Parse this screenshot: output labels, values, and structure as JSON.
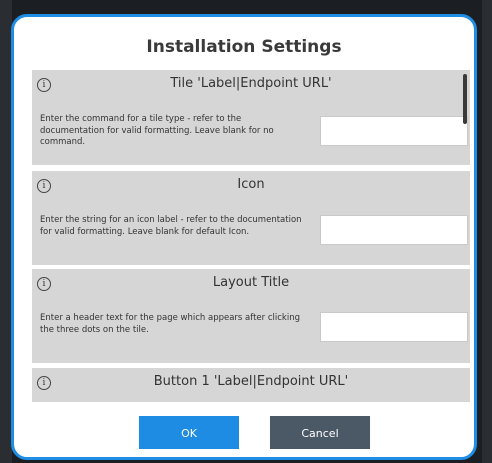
{
  "dialog": {
    "title": "Installation Settings",
    "accent_color": "#1f8de3"
  },
  "settings": [
    {
      "icon": "info-icon",
      "title": "Tile 'Label|Endpoint URL'",
      "description": "Enter the command for a tile type - refer to the documentation for valid formatting.  Leave blank for no command.",
      "value": ""
    },
    {
      "icon": "info-icon",
      "title": "Icon",
      "description": "Enter the string for an icon label - refer to the documentation for valid formatting. Leave blank for default Icon.",
      "value": ""
    },
    {
      "icon": "info-icon",
      "title": "Layout Title",
      "description": "Enter a header text for the page which appears after clicking the three dots on the tile.",
      "value": ""
    },
    {
      "icon": "info-icon",
      "title": "Button 1 'Label|Endpoint URL'",
      "description": "",
      "value": ""
    }
  ],
  "buttons": {
    "ok_label": "OK",
    "cancel_label": "Cancel",
    "ok_color": "#1e8ce2",
    "cancel_color": "#4b5967"
  },
  "info_glyph": "i"
}
